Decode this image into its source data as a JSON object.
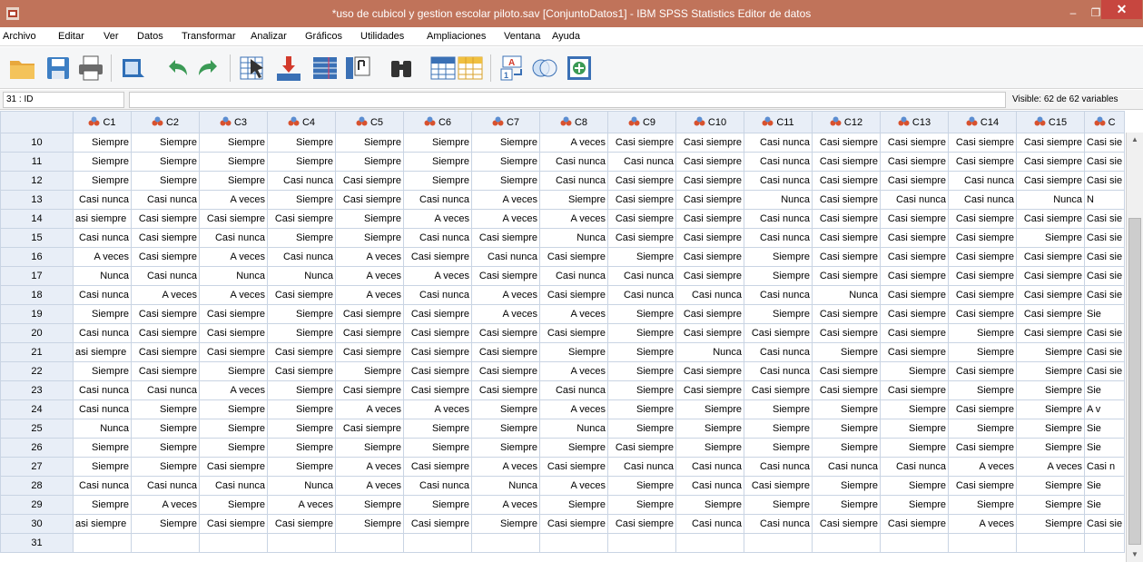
{
  "window": {
    "title": "*uso de cubicol y gestion escolar piloto.sav [ConjuntoDatos1] - IBM SPSS Statistics Editor de datos",
    "minimize": "–",
    "maximize": "❐",
    "close": "✕"
  },
  "menu": [
    "Archivo",
    "Editar",
    "Ver",
    "Datos",
    "Transformar",
    "Analizar",
    "Gráficos",
    "Utilidades",
    "Ampliaciones",
    "Ventana",
    "Ayuda"
  ],
  "toolbar": {
    "icons": [
      "open-file-icon",
      "save-icon",
      "print-icon",
      "dialog-recall-icon",
      "undo-icon",
      "redo-icon",
      "go-to-case-icon",
      "go-to-variable-icon",
      "variables-icon",
      "run-descriptives-icon",
      "find-icon",
      "insert-cases-icon",
      "insert-variable-icon",
      "value-labels-icon",
      "use-sets-icon",
      "show-all-variables-icon"
    ]
  },
  "editor": {
    "cell_ref": "31 : ID",
    "cell_value": "",
    "visible_vars": "Visible: 62 de 62 variables"
  },
  "colors": {
    "title_bar": "#c0735a",
    "close_button": "#c7463f",
    "header_bg": "#e8eef7",
    "grid_line": "#c9d4e3"
  },
  "columns": [
    "C1",
    "C2",
    "C3",
    "C4",
    "C5",
    "C6",
    "C7",
    "C8",
    "C9",
    "C10",
    "C11",
    "C12",
    "C13",
    "C14",
    "C15",
    "C"
  ],
  "rows": [
    {
      "n": "10",
      "cells": [
        "Siempre",
        "Siempre",
        "Siempre",
        "Siempre",
        "Siempre",
        "Siempre",
        "Siempre",
        "A veces",
        "Casi siempre",
        "Casi siempre",
        "Casi nunca",
        "Casi siempre",
        "Casi siempre",
        "Casi siempre",
        "Casi siempre",
        "Casi sie"
      ]
    },
    {
      "n": "11",
      "cells": [
        "Siempre",
        "Siempre",
        "Siempre",
        "Siempre",
        "Siempre",
        "Siempre",
        "Siempre",
        "Casi nunca",
        "Casi nunca",
        "Casi siempre",
        "Casi nunca",
        "Casi siempre",
        "Casi siempre",
        "Casi siempre",
        "Casi siempre",
        "Casi sie"
      ]
    },
    {
      "n": "12",
      "cells": [
        "Siempre",
        "Siempre",
        "Siempre",
        "Casi nunca",
        "Casi siempre",
        "Siempre",
        "Siempre",
        "Casi nunca",
        "Casi siempre",
        "Casi siempre",
        "Casi nunca",
        "Casi siempre",
        "Casi siempre",
        "Casi nunca",
        "Casi siempre",
        "Casi sie"
      ]
    },
    {
      "n": "13",
      "cells": [
        "Casi nunca",
        "Casi nunca",
        "A veces",
        "Siempre",
        "Casi siempre",
        "Casi nunca",
        "A veces",
        "Siempre",
        "Casi siempre",
        "Casi siempre",
        "Nunca",
        "Casi siempre",
        "Casi nunca",
        "Casi nunca",
        "Nunca",
        "N"
      ]
    },
    {
      "n": "14",
      "cells": [
        "asi siempre",
        "Casi siempre",
        "Casi siempre",
        "Casi siempre",
        "Siempre",
        "A veces",
        "A veces",
        "A veces",
        "Casi siempre",
        "Casi siempre",
        "Casi nunca",
        "Casi siempre",
        "Casi siempre",
        "Casi siempre",
        "Casi siempre",
        "Casi sie"
      ]
    },
    {
      "n": "15",
      "cells": [
        "Casi nunca",
        "Casi siempre",
        "Casi nunca",
        "Siempre",
        "Siempre",
        "Casi nunca",
        "Casi siempre",
        "Nunca",
        "Casi siempre",
        "Casi siempre",
        "Casi nunca",
        "Casi siempre",
        "Casi siempre",
        "Casi siempre",
        "Siempre",
        "Casi sie"
      ]
    },
    {
      "n": "16",
      "cells": [
        "A veces",
        "Casi siempre",
        "A veces",
        "Casi nunca",
        "A veces",
        "Casi siempre",
        "Casi nunca",
        "Casi siempre",
        "Siempre",
        "Casi siempre",
        "Siempre",
        "Casi siempre",
        "Casi siempre",
        "Casi siempre",
        "Casi siempre",
        "Casi sie"
      ]
    },
    {
      "n": "17",
      "cells": [
        "Nunca",
        "Casi nunca",
        "Nunca",
        "Nunca",
        "A veces",
        "A veces",
        "Casi siempre",
        "Casi nunca",
        "Casi nunca",
        "Casi siempre",
        "Siempre",
        "Casi siempre",
        "Casi siempre",
        "Casi siempre",
        "Casi siempre",
        "Casi sie"
      ]
    },
    {
      "n": "18",
      "cells": [
        "Casi nunca",
        "A veces",
        "A veces",
        "Casi siempre",
        "A veces",
        "Casi nunca",
        "A veces",
        "Casi siempre",
        "Casi nunca",
        "Casi nunca",
        "Casi nunca",
        "Nunca",
        "Casi siempre",
        "Casi siempre",
        "Casi siempre",
        "Casi sie"
      ]
    },
    {
      "n": "19",
      "cells": [
        "Siempre",
        "Casi siempre",
        "Casi siempre",
        "Siempre",
        "Casi siempre",
        "Casi siempre",
        "A veces",
        "A veces",
        "Siempre",
        "Casi siempre",
        "Siempre",
        "Casi siempre",
        "Casi siempre",
        "Casi siempre",
        "Casi siempre",
        "Sie"
      ]
    },
    {
      "n": "20",
      "cells": [
        "Casi nunca",
        "Casi siempre",
        "Casi siempre",
        "Siempre",
        "Casi siempre",
        "Casi siempre",
        "Casi siempre",
        "Casi siempre",
        "Siempre",
        "Casi siempre",
        "Casi siempre",
        "Casi siempre",
        "Casi siempre",
        "Siempre",
        "Casi siempre",
        "Casi sie"
      ]
    },
    {
      "n": "21",
      "cells": [
        "asi siempre",
        "Casi siempre",
        "Casi siempre",
        "Casi siempre",
        "Casi siempre",
        "Casi siempre",
        "Casi siempre",
        "Siempre",
        "Siempre",
        "Nunca",
        "Casi nunca",
        "Siempre",
        "Casi siempre",
        "Siempre",
        "Siempre",
        "Casi sie"
      ]
    },
    {
      "n": "22",
      "cells": [
        "Siempre",
        "Casi siempre",
        "Siempre",
        "Casi siempre",
        "Siempre",
        "Casi siempre",
        "Casi siempre",
        "A veces",
        "Siempre",
        "Casi siempre",
        "Casi nunca",
        "Casi siempre",
        "Siempre",
        "Casi siempre",
        "Siempre",
        "Casi sie"
      ]
    },
    {
      "n": "23",
      "cells": [
        "Casi nunca",
        "Casi nunca",
        "A veces",
        "Siempre",
        "Casi siempre",
        "Casi siempre",
        "Casi siempre",
        "Casi nunca",
        "Siempre",
        "Casi siempre",
        "Casi siempre",
        "Casi siempre",
        "Casi siempre",
        "Siempre",
        "Siempre",
        "Sie"
      ]
    },
    {
      "n": "24",
      "cells": [
        "Casi nunca",
        "Siempre",
        "Siempre",
        "Siempre",
        "A veces",
        "A veces",
        "Siempre",
        "A veces",
        "Siempre",
        "Siempre",
        "Siempre",
        "Siempre",
        "Siempre",
        "Casi siempre",
        "Siempre",
        "A v"
      ]
    },
    {
      "n": "25",
      "cells": [
        "Nunca",
        "Siempre",
        "Siempre",
        "Siempre",
        "Casi siempre",
        "Siempre",
        "Siempre",
        "Nunca",
        "Siempre",
        "Siempre",
        "Siempre",
        "Siempre",
        "Siempre",
        "Siempre",
        "Siempre",
        "Sie"
      ]
    },
    {
      "n": "26",
      "cells": [
        "Siempre",
        "Siempre",
        "Siempre",
        "Siempre",
        "Siempre",
        "Siempre",
        "Siempre",
        "Siempre",
        "Casi siempre",
        "Siempre",
        "Siempre",
        "Siempre",
        "Siempre",
        "Casi siempre",
        "Siempre",
        "Sie"
      ]
    },
    {
      "n": "27",
      "cells": [
        "Siempre",
        "Siempre",
        "Casi siempre",
        "Siempre",
        "A veces",
        "Casi siempre",
        "A veces",
        "Casi siempre",
        "Casi nunca",
        "Casi nunca",
        "Casi nunca",
        "Casi nunca",
        "Casi nunca",
        "A veces",
        "A veces",
        "Casi n"
      ]
    },
    {
      "n": "28",
      "cells": [
        "Casi nunca",
        "Casi nunca",
        "Casi nunca",
        "Nunca",
        "A veces",
        "Casi nunca",
        "Nunca",
        "A veces",
        "Siempre",
        "Casi nunca",
        "Casi siempre",
        "Siempre",
        "Siempre",
        "Casi siempre",
        "Siempre",
        "Sie"
      ]
    },
    {
      "n": "29",
      "cells": [
        "Siempre",
        "A veces",
        "Siempre",
        "A veces",
        "Siempre",
        "Siempre",
        "A veces",
        "Siempre",
        "Siempre",
        "Siempre",
        "Siempre",
        "Siempre",
        "Siempre",
        "Siempre",
        "Siempre",
        "Sie"
      ]
    },
    {
      "n": "30",
      "cells": [
        "asi siempre",
        "Siempre",
        "Casi siempre",
        "Casi siempre",
        "Siempre",
        "Casi siempre",
        "Siempre",
        "Casi siempre",
        "Casi siempre",
        "Casi nunca",
        "Casi nunca",
        "Casi siempre",
        "Casi siempre",
        "A veces",
        "Siempre",
        "Casi sie"
      ]
    },
    {
      "n": "31",
      "cells": [
        "",
        "",
        "",
        "",
        "",
        "",
        "",
        "",
        "",
        "",
        "",
        "",
        "",
        "",
        "",
        ""
      ]
    }
  ]
}
